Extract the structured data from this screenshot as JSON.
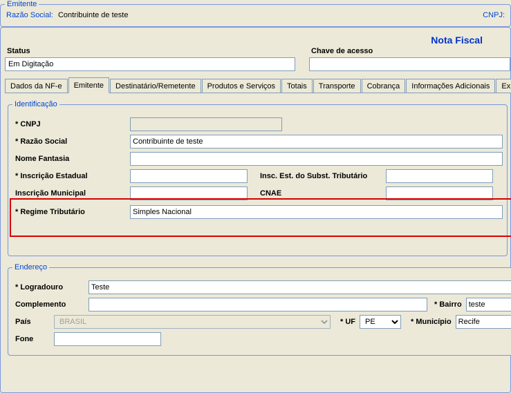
{
  "header": {
    "emitente_legend": "Emitente",
    "razao_social_label": "Razão Social:",
    "razao_social_value": "Contribuinte de teste",
    "cnpj_label": "CNPJ:"
  },
  "title": "Nota Fiscal",
  "status": {
    "label": "Status",
    "value": "Em Digitação"
  },
  "chave": {
    "label": "Chave de acesso",
    "value": ""
  },
  "tabs": [
    "Dados da NF-e",
    "Emitente",
    "Destinatário/Remetente",
    "Produtos e Serviços",
    "Totais",
    "Transporte",
    "Cobrança",
    "Informações Adicionais",
    "Exportaç"
  ],
  "identificacao": {
    "legend": "Identificação",
    "cnpj_label": "* CNPJ",
    "cnpj_value": "",
    "razao_label": "* Razão Social",
    "razao_value": "Contribuinte de teste",
    "fantasia_label": "Nome Fantasia",
    "fantasia_value": "",
    "ie_label": "* Inscrição Estadual",
    "ie_value": "",
    "iesst_label": "Insc. Est. do Subst. Tributário",
    "iesst_value": "",
    "im_label": "Inscrição Municipal",
    "im_value": "",
    "cnae_label": "CNAE",
    "cnae_value": "",
    "regime_label": "* Regime Tributário",
    "regime_value": "Simples Nacional"
  },
  "endereco": {
    "legend": "Endereço",
    "logradouro_label": "* Logradouro",
    "logradouro_value": "Teste",
    "complemento_label": "Complemento",
    "complemento_value": "",
    "bairro_label": "* Bairro",
    "bairro_value": "teste",
    "pais_label": "País",
    "pais_value": "BRASIL",
    "uf_label": "* UF",
    "uf_value": "PE",
    "municipio_label": "* Município",
    "municipio_value": "Recife",
    "fone_label": "Fone",
    "fone_value": ""
  }
}
